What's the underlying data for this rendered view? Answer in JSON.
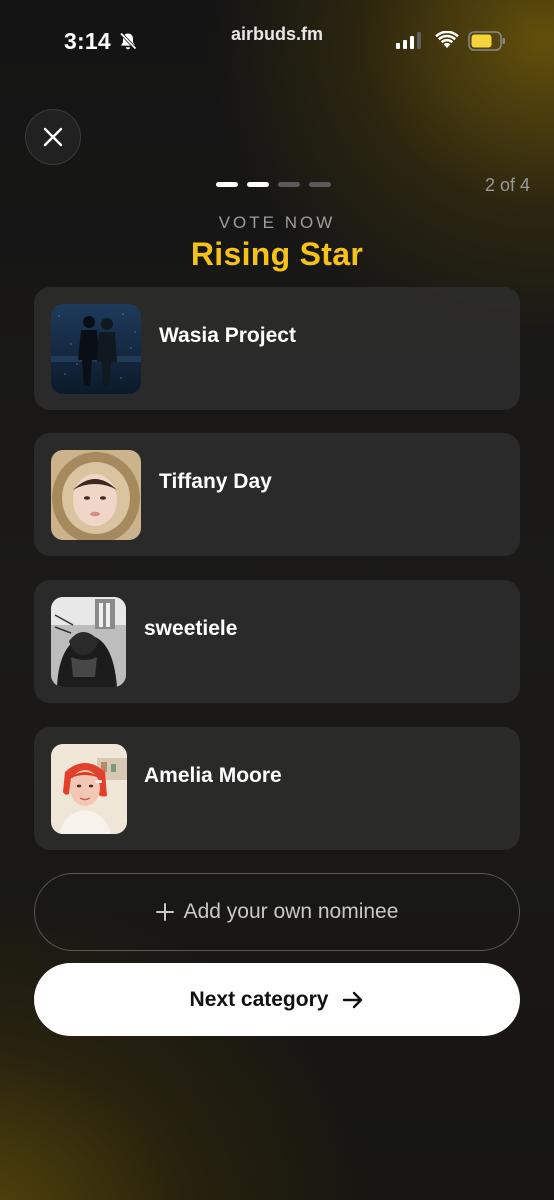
{
  "status_bar": {
    "time": "3:14",
    "url": "airbuds.fm",
    "icons": [
      "bell-muted-icon",
      "signal-icon",
      "wifi-icon",
      "battery-icon"
    ],
    "battery_color": "#f5d33b"
  },
  "header": {
    "close_icon": "close-icon",
    "step_count": "2 of 4",
    "progress": {
      "total": 4,
      "active": 2
    }
  },
  "section": {
    "kicker": "VOTE NOW",
    "title": "Rising Star",
    "title_color": "#f6c21a"
  },
  "nominees": [
    {
      "name": "Wasia Project"
    },
    {
      "name": "Tiffany Day"
    },
    {
      "name": "sweetiele"
    },
    {
      "name": "Amelia Moore"
    }
  ],
  "actions": {
    "add_nominee": "Add your own nominee",
    "next_category": "Next category",
    "add_icon": "plus-icon",
    "next_icon": "arrow-right-icon"
  }
}
